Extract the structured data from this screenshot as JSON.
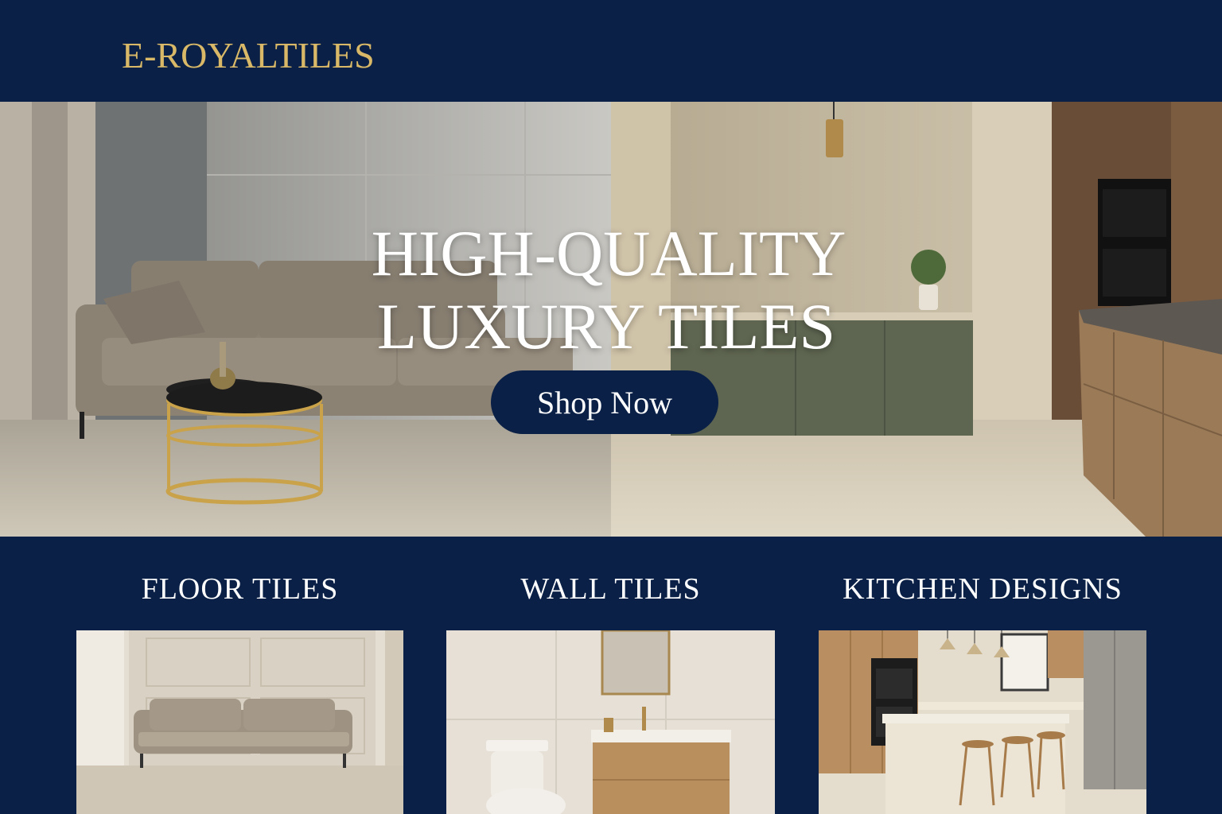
{
  "brand": {
    "logo": "E-ROYALTILES"
  },
  "hero": {
    "title_line1": "HIGH-QUALITY",
    "title_line2": "LUXURY TILES",
    "cta_label": "Shop Now"
  },
  "categories": [
    {
      "label": "FLOOR TILES"
    },
    {
      "label": "WALL TILES"
    },
    {
      "label": "KITCHEN DESIGNS"
    }
  ],
  "colors": {
    "navy": "#0a2046",
    "gold": "#d9b968",
    "white": "#ffffff"
  }
}
